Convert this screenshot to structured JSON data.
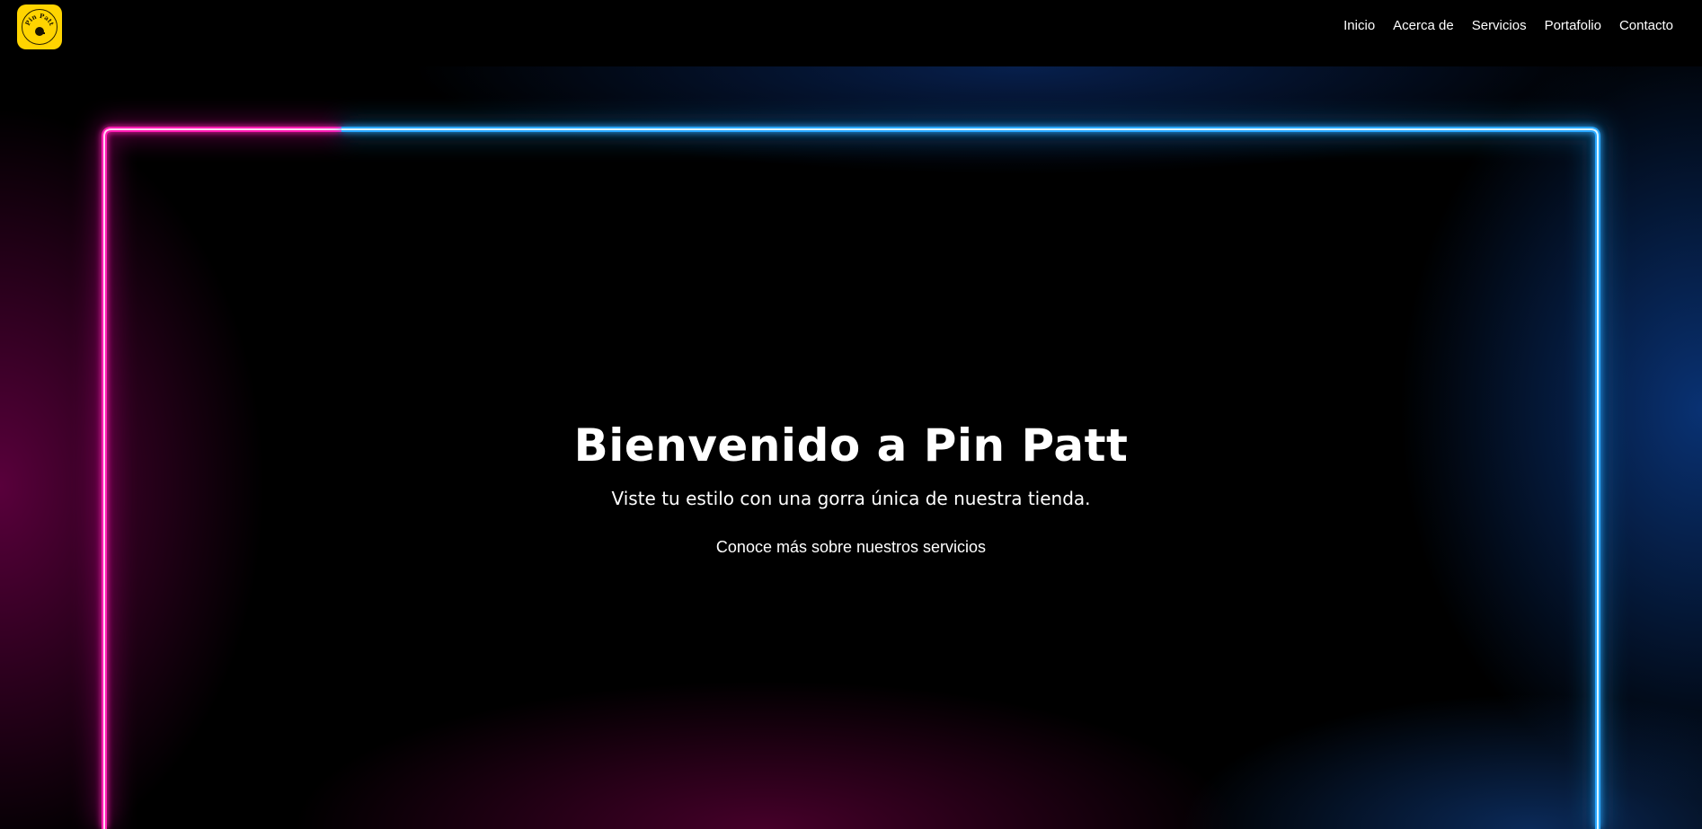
{
  "brand": {
    "logo_text": "Pin Patt",
    "logo_icon": "cap-badge-icon",
    "logo_bg": "#ffd400"
  },
  "nav": {
    "items": [
      {
        "label": "Inicio"
      },
      {
        "label": "Acerca de"
      },
      {
        "label": "Servicios"
      },
      {
        "label": "Portafolio"
      },
      {
        "label": "Contacto"
      }
    ]
  },
  "hero": {
    "title": "Bienvenido a Pin Patt",
    "subtitle": "Viste tu estilo con una gorra única de nuestra tienda.",
    "cta_link": "Conoce más sobre nuestros servicios",
    "neon_pink": "#ff1fb4",
    "neon_blue": "#2aa8ff"
  }
}
